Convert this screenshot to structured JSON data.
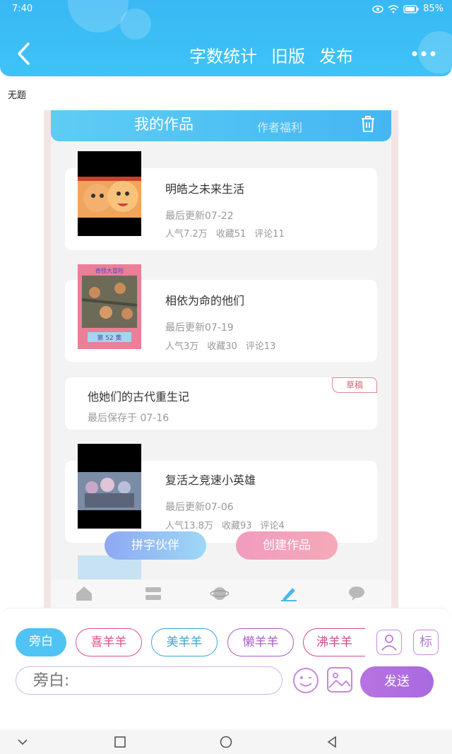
{
  "status_bar": {
    "time": "7:40",
    "battery": "85%"
  },
  "app_bar": {
    "actions": [
      "字数统计",
      "旧版",
      "发布"
    ]
  },
  "document": {
    "title": "无题"
  },
  "screenshot": {
    "header": {
      "title": "我的作品",
      "tab": "作者福利"
    },
    "works": [
      {
        "title": "明皓之未来生活",
        "updated": "最后更新07-22",
        "popularity": "人气7.2万",
        "favorites": "收藏51",
        "comments": "评论11"
      },
      {
        "title": "相依为命的他们",
        "updated": "最后更新07-19",
        "popularity": "人气3万",
        "favorites": "收藏30",
        "comments": "评论13",
        "cover_caption_top": "奇怪大冒险",
        "cover_caption_bottom": "第 52 集"
      },
      {
        "title": "他她们的古代重生记",
        "updated": "最后保存于 07-16",
        "badge": "草稿"
      },
      {
        "title": "复活之竞速小英雄",
        "updated": "最后更新07-06",
        "popularity": "人气13.8万",
        "favorites": "收藏93",
        "comments": "评论4"
      }
    ],
    "buttons": {
      "partner": "拼字伙伴",
      "create": "创建作品"
    },
    "tab_icons": [
      "home-icon",
      "list-icon",
      "planet-icon",
      "pen-icon",
      "chat-icon"
    ]
  },
  "composer": {
    "roles": [
      "旁白",
      "喜羊羊",
      "美羊羊",
      "懒羊羊",
      "沸羊羊"
    ],
    "profile_button": "",
    "tag_button": "标",
    "input_placeholder": "旁白:",
    "send_label": "发送"
  },
  "colors": {
    "primary": "#3ec3f6",
    "send": "#b873e0"
  }
}
